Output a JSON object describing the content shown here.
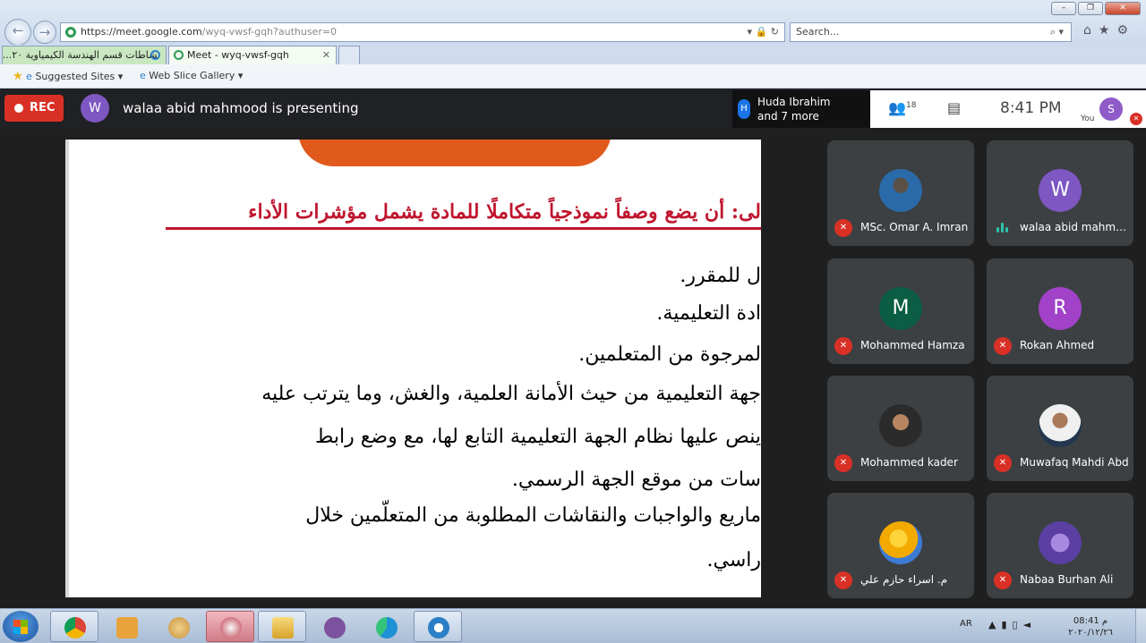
{
  "browser": {
    "url_main": "https://meet.google.com",
    "url_rest": "/wyq-vwsf-gqh?authuser=0",
    "search_placeholder": "Search...",
    "tabs": [
      {
        "label": "نشاطات قسم الهندسة الكيمياوية ٢٠..."
      },
      {
        "label": "Meet - wyq-vwsf-gqh"
      }
    ],
    "favorites": [
      {
        "label": "Suggested Sites"
      },
      {
        "label": "Web Slice Gallery"
      }
    ],
    "window_buttons": [
      "–",
      "❐",
      "✕"
    ]
  },
  "meet": {
    "rec_label": "REC",
    "presenter_initial": "W",
    "presenter_text": "walaa abid mahmood is presenting",
    "notification": {
      "initial": "H",
      "line1": "Huda Ibrahim",
      "line2": "and 7 more"
    },
    "people_count": "18",
    "clock": "8:41  PM",
    "you_initial": "S",
    "you_label": "You"
  },
  "slide": {
    "title": "لى: أن يضع وصفاً نموذجياً متكاملًا للمادة يشمل مؤشرات الأداء",
    "lines": [
      "ل للمقرر.",
      "ادة التعليمية.",
      "لمرجوة من المتعلمين.",
      "جهة التعليمية من حيث الأمانة العلمية، والغش، وما يترتب عليه",
      "ينص عليها نظام الجهة التعليمية التابع لها، مع وضع رابط",
      "سات من موقع الجهة الرسمي.",
      "ماريع والواجبات والنقاشات المطلوبة من المتعلّمين خلال",
      "راسي."
    ]
  },
  "participants": [
    {
      "name": "MSc. Omar A. Imran",
      "initial": "",
      "color": "",
      "mic": "muted"
    },
    {
      "name": "walaa abid mahmood",
      "initial": "W",
      "color": "#7e57c2",
      "mic": "speaking"
    },
    {
      "name": "Mohammed Hamza",
      "initial": "M",
      "color": "#0b5d43",
      "mic": "muted"
    },
    {
      "name": "Rokan Ahmed",
      "initial": "R",
      "color": "#a142c9",
      "mic": "muted"
    },
    {
      "name": "Mohammed kader",
      "initial": "",
      "color": "",
      "mic": "muted"
    },
    {
      "name": "Muwafaq Mahdi Abd",
      "initial": "",
      "color": "",
      "mic": "muted"
    },
    {
      "name": "م. اسراء حازم علي",
      "initial": "",
      "color": "",
      "mic": "muted"
    },
    {
      "name": "Nabaa Burhan Ali",
      "initial": "",
      "color": "",
      "mic": "muted"
    }
  ],
  "taskbar": {
    "language": "AR",
    "time": "08:41 م",
    "date": "٢٠٢٠/١٢/٢٦"
  },
  "colors": {
    "meet_bg": "#202124",
    "tile_bg": "#3c4043",
    "rec_red": "#d93025",
    "slide_title_red": "#c0152e",
    "banner_orange": "#e05a1c"
  }
}
